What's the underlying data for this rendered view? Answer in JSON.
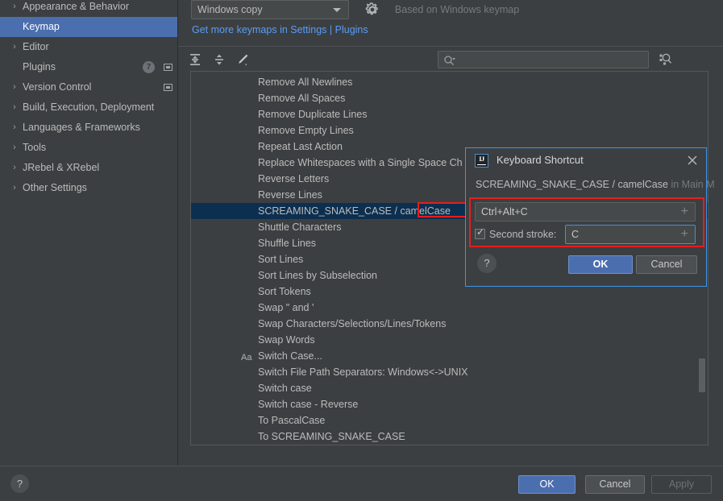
{
  "sidebar": {
    "items": [
      {
        "label": "Appearance & Behavior",
        "twisty": "›",
        "selected": false,
        "badge": null,
        "square": false
      },
      {
        "label": "Keymap",
        "twisty": "",
        "selected": true,
        "badge": null,
        "square": false
      },
      {
        "label": "Editor",
        "twisty": "›",
        "selected": false,
        "badge": null,
        "square": false
      },
      {
        "label": "Plugins",
        "twisty": "",
        "selected": false,
        "badge": "7",
        "square": true
      },
      {
        "label": "Version Control",
        "twisty": "›",
        "selected": false,
        "badge": null,
        "square": true
      },
      {
        "label": "Build, Execution, Deployment",
        "twisty": "›",
        "selected": false,
        "badge": null,
        "square": false
      },
      {
        "label": "Languages & Frameworks",
        "twisty": "›",
        "selected": false,
        "badge": null,
        "square": false
      },
      {
        "label": "Tools",
        "twisty": "›",
        "selected": false,
        "badge": null,
        "square": false
      },
      {
        "label": "JRebel & XRebel",
        "twisty": "›",
        "selected": false,
        "badge": null,
        "square": false
      },
      {
        "label": "Other Settings",
        "twisty": "›",
        "selected": false,
        "badge": null,
        "square": false
      }
    ]
  },
  "keymap": {
    "selected_keymap": "Windows copy",
    "based_on": "Based on Windows keymap",
    "get_more_prefix": "Get more keymaps in Settings",
    "get_more_separator": " | ",
    "get_more_suffix": "Plugins",
    "gear_icon": "gear-icon",
    "link_color": "#589df6"
  },
  "toolbar": {
    "expand_all_icon": "expand-all-icon",
    "collapse_all_icon": "collapse-all-icon",
    "edit_shortcut_icon": "edit-pencil-icon",
    "search_placeholder": "",
    "search_value": "",
    "search_icon": "search-magnifier-icon",
    "find_actions_icon": "find-by-shortcut-icon"
  },
  "actions_list": {
    "rows": [
      {
        "label": "Remove All Newlines",
        "icon": "",
        "selected": false
      },
      {
        "label": "Remove All Spaces",
        "icon": "",
        "selected": false
      },
      {
        "label": "Remove Duplicate Lines",
        "icon": "",
        "selected": false
      },
      {
        "label": "Remove Empty Lines",
        "icon": "",
        "selected": false
      },
      {
        "label": "Repeat Last Action",
        "icon": "",
        "selected": false
      },
      {
        "label": "Replace Whitespaces with a Single Space Ch",
        "icon": "",
        "selected": false
      },
      {
        "label": "Reverse Letters",
        "icon": "",
        "selected": false
      },
      {
        "label": "Reverse Lines",
        "icon": "",
        "selected": false
      },
      {
        "label": "SCREAMING_SNAKE_CASE / camelCase",
        "icon": "",
        "selected": true
      },
      {
        "label": "Shuttle Characters",
        "icon": "",
        "selected": false
      },
      {
        "label": "Shuffle Lines",
        "icon": "",
        "selected": false
      },
      {
        "label": "Sort Lines",
        "icon": "",
        "selected": false
      },
      {
        "label": "Sort Lines by Subselection",
        "icon": "",
        "selected": false
      },
      {
        "label": "Sort Tokens",
        "icon": "",
        "selected": false
      },
      {
        "label": "Swap \" and '",
        "icon": "",
        "selected": false
      },
      {
        "label": "Swap Characters/Selections/Lines/Tokens",
        "icon": "",
        "selected": false
      },
      {
        "label": "Swap Words",
        "icon": "",
        "selected": false
      },
      {
        "label": "Switch Case...",
        "icon": "Aa",
        "selected": false
      },
      {
        "label": "Switch File Path Separators: Windows<->UNIX",
        "icon": "",
        "selected": false
      },
      {
        "label": "Switch case",
        "icon": "",
        "selected": false
      },
      {
        "label": "Switch case - Reverse",
        "icon": "",
        "selected": false
      },
      {
        "label": "To PascalCase",
        "icon": "",
        "selected": false
      },
      {
        "label": "To SCREAMING_SNAKE_CASE",
        "icon": "",
        "selected": false
      }
    ],
    "selected_row_color": "#0d2f4f",
    "highlight_box_color": "#e81d1d"
  },
  "dialog": {
    "title": "Keyboard Shortcut",
    "logo_text": "IJ",
    "close_icon": "close-x-icon",
    "subtitle_action": "SCREAMING_SNAKE_CASE / camelCase",
    "subtitle_context": " in Main M",
    "first_stroke_value": "Ctrl+Alt+C",
    "first_stroke_plus": "+",
    "second_stroke_checked": true,
    "second_stroke_label": "Second stroke:",
    "second_stroke_value": "C",
    "second_stroke_plus": "+",
    "help_label": "?",
    "ok_label": "OK",
    "cancel_label": "Cancel",
    "border_color": "#3d95e8",
    "focus_color": "#4a8fd0"
  },
  "footer": {
    "help_label": "?",
    "ok_label": "OK",
    "cancel_label": "Cancel",
    "apply_label": "Apply"
  }
}
